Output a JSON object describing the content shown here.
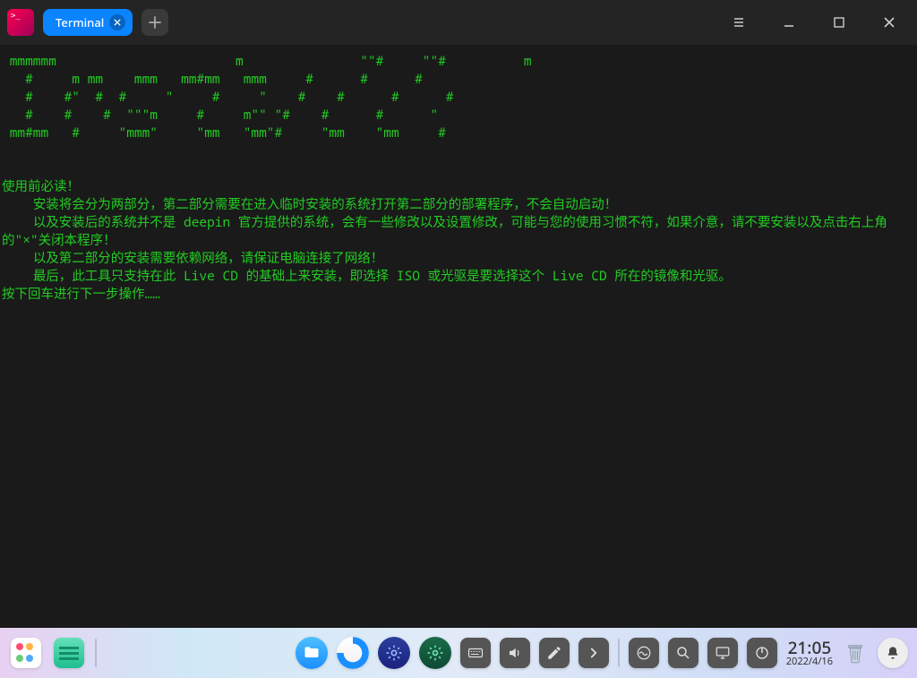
{
  "titlebar": {
    "app_prompt": ">_",
    "tab_label": "Terminal"
  },
  "terminal": {
    "lines": [
      " mmmmmm                       m               \"\"#     \"\"#          m",
      "   #     m mm    mmm   mm#mm   mmm     #      #      #",
      "   #    #\"  #  #     \"     #     \"    #    #      #      #",
      "   #    #    #  \"\"\"m     #     m\"\" \"#    #      #      \"",
      " mm#mm   #     \"mmm\"     \"mm   \"mm\"#     \"mm    \"mm     #",
      "",
      "",
      "使用前必读！",
      "    安装将会分为两部分，第二部分需要在进入临时安装的系统打开第二部分的部署程序，不会自动启动！",
      "    以及安装后的系统并不是 deepin 官方提供的系统，会有一些修改以及设置修改，可能与您的使用习惯不符，如果介意，请不要安装以及点击右上角的\"×\"关闭本程序！",
      "    以及第二部分的安装需要依赖网络，请保证电脑连接了网络！",
      "    最后，此工具只支持在此 Live CD 的基础上来安装，即选择 ISO 或光驱是要选择这个 Live CD 所在的镜像和光驱。",
      "按下回车进行下一步操作……"
    ]
  },
  "dock": {
    "time": "21:05",
    "date": "2022/4/16"
  }
}
